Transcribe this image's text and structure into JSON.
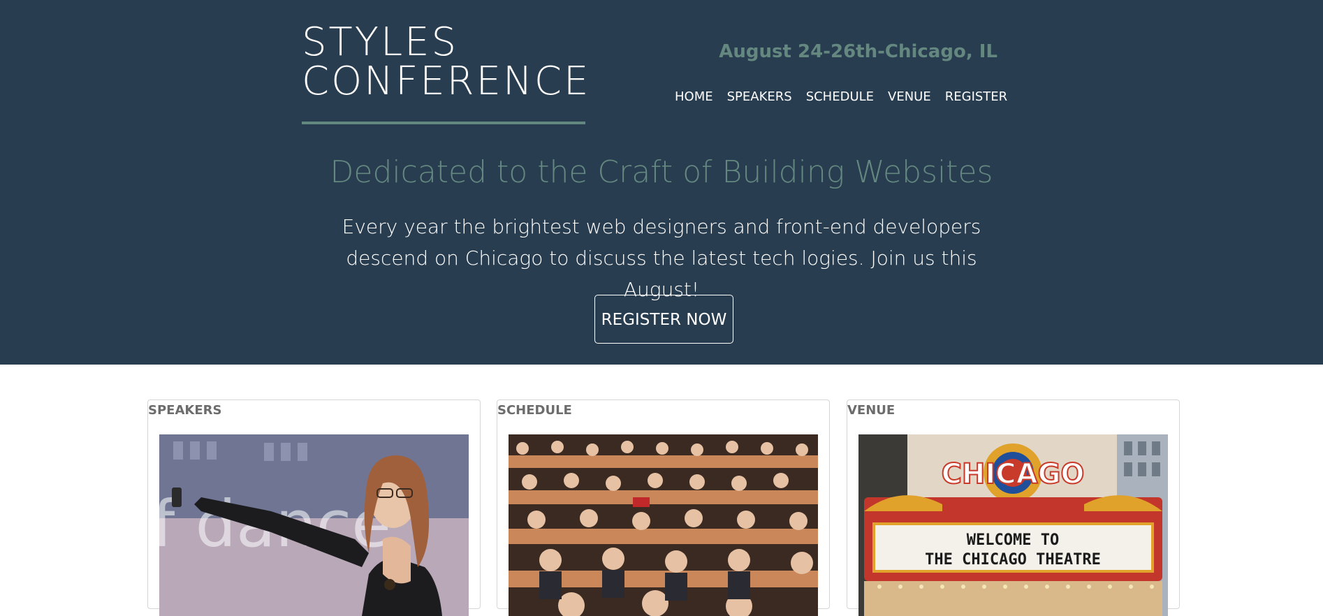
{
  "header": {
    "logo_line1": "STYLES",
    "logo_line2": "CONFERENCE",
    "date_location": "August 24-26th-Chicago, IL",
    "nav": [
      "HOME",
      "SPEAKERS",
      "SCHEDULE",
      "VENUE",
      "REGISTER"
    ]
  },
  "hero": {
    "tagline": "Dedicated to the Craft of Building Websites",
    "intro": "Every year the brightest web designers and front-end developers descend on Chicago to discuss the latest tech logies. Join us this August!",
    "cta_label": "REGISTER NOW"
  },
  "cards": [
    {
      "title": "SPEAKERS",
      "image": "speaker-photo"
    },
    {
      "title": "SCHEDULE",
      "image": "audience-photo"
    },
    {
      "title": "VENUE",
      "image": "chicago-theatre-photo"
    }
  ],
  "venue_sign": {
    "marquee_brand": "CHICAGO",
    "marquee_line1": "WELCOME TO",
    "marquee_line2": "THE CHICAGO THEATRE"
  },
  "colors": {
    "hero_bg": "#293d50",
    "accent": "#648880",
    "text_light": "#ffffff",
    "card_border": "#d6d6d6",
    "card_title": "#6c6c6c"
  }
}
